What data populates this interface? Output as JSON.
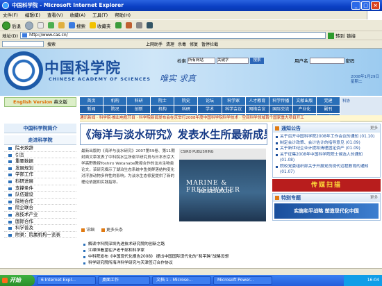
{
  "window": {
    "title": "中国科学院 - Microsoft Internet Explorer"
  },
  "menu": [
    "文件(F)",
    "编辑(E)",
    "查看(V)",
    "收藏(A)",
    "工具(T)",
    "帮助(H)"
  ],
  "toolbar": {
    "back": "后退",
    "search": "搜索",
    "favorites": "收藏夹"
  },
  "address": {
    "label": "地址(D)",
    "url": "http://www.cas.cn/",
    "go": "转到",
    "links": "链接"
  },
  "linkbar": {
    "items": [
      "搜索",
      "上网助手",
      "清理",
      "杀毒",
      "修复",
      "暂停拦截"
    ]
  },
  "header": {
    "logo_cn": "中国科学院",
    "logo_en": "CHINESE ACADEMY OF SCIENCES",
    "motto": "唯实 求真",
    "search_label": "检索",
    "search_select": "所有网站",
    "search_input": "关键字",
    "search_btn": "搜索",
    "user_label": "用户名",
    "pwd_label": "密码",
    "date": "2008年1月29日",
    "weekday": "星期二"
  },
  "english_version": {
    "en": "English Version",
    "cn": "英文版"
  },
  "nav": {
    "rows": [
      [
        "首页",
        "机构",
        "科研",
        "院士",
        "院史",
        "论坛",
        "科学家",
        "人才教育",
        "科学传播",
        "文献出版",
        "党建"
      ],
      [
        "新闻",
        "院况",
        "创新",
        "机构",
        "科研",
        "学术",
        "科学会议",
        "网络会议",
        "国际交流",
        "产业化",
        "副刊"
      ],
      [
        "动态",
        "联系",
        "图片",
        "专题",
        "信息",
        "研究",
        "院地合作",
        "网站",
        "院务公开",
        "通知",
        "下载"
      ]
    ],
    "badge": "科协"
  },
  "ticker": "通讯新闻 · 科学院·推出电视节目 · 科学院新闻发布会在京举行2008年度中国科学院科学技术 · 空间科学领域首个国家重大项目开工",
  "left": {
    "summary": "中国科学院简介",
    "section": "走进科学院",
    "items": [
      "院长致辞",
      "引言",
      "重要数据",
      "发展规划",
      "学部工作",
      "科研进展",
      "支撑条件",
      "队伍建设",
      "院地合作",
      "院企联合",
      "高技术产业",
      "国际合作",
      "科学普及",
      "附录：院属机构一览表"
    ]
  },
  "headline": "《海洋与淡水研究》发表水生所最新成果",
  "article": "最新出版的《海洋与淡水研究》2007第59卷、第11期封面文章发表了中科院水生所谢平研究员与日本东京大学高野教授Toshiro Watanabe教授合作的淡水生物类论文，该研究揭示了湖泊生态系统中鱼类群落结构变化对浮游动物多样性的影响，为淡水生态修复提供了新的理论依据和实践指导。",
  "cover": {
    "top": "CSIRO PUBLISHING",
    "t1": "MARINE & FRESHWATER",
    "t2": "RESEARCH"
  },
  "more": [
    "详细",
    "更多头条"
  ],
  "news": [
    "解读中科院深圳先进技术研究院的创新之路",
    "江绵恒看望在沪老干部和科学家",
    "中科院发布《中国现代化报告2008》 提出中国国际现代化的“和平跨”战略设想",
    "科学研究院所海洋科学研究与天津签订合作协议"
  ],
  "notice": {
    "title": "通知公告",
    "more": "更多",
    "items": [
      "关于召开中国科学院2008年工作会议的通知 (01.10)",
      "制定会计政策、会计估计的指导意见 (01.09)",
      "关于新世纪企业计提和清理固定资产 (01.09)",
      "关于征集2008年中国科学院院士候选人的通知 (01.08)",
      "院校党委组织部关于开展党员现代远程教育的通知 (01.07)"
    ]
  },
  "banner": "传媒扫描",
  "special": {
    "title": "特别专题",
    "more": "更多",
    "banner1": "实施和平战略 塑造现代化中国"
  },
  "taskbar": {
    "start": "开始",
    "tasks": [
      "6 Internet Expl...",
      "桌面工作",
      "文档 1 - Microso...",
      "Microsoft Power..."
    ],
    "time": "16:04"
  }
}
